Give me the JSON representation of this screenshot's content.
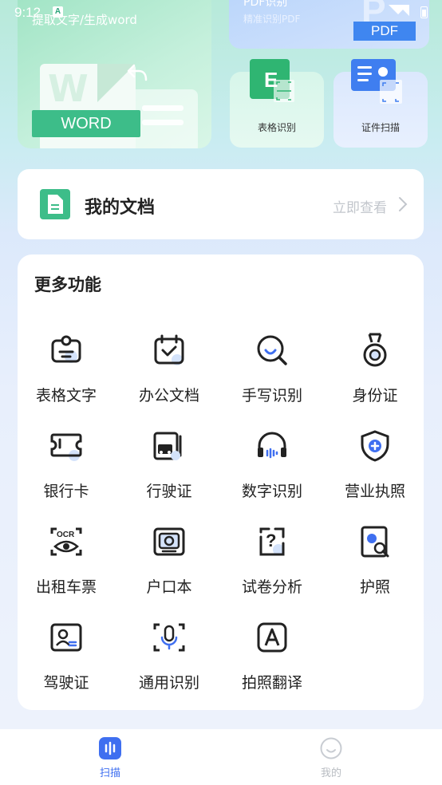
{
  "status_bar": {
    "time": "9:12",
    "notification_glyph": "A"
  },
  "hero": {
    "word_card": {
      "subtitle": "提取文字/生成word",
      "badge": "WORD",
      "watermark": "W"
    },
    "pdf_card": {
      "title": "PDF识别",
      "subtitle": "精准识别PDF",
      "badge": "PDF",
      "watermark": "P"
    },
    "table_card": {
      "label": "表格识别"
    },
    "id_card": {
      "label": "证件扫描"
    }
  },
  "my_docs": {
    "title": "我的文档",
    "link": "立即查看"
  },
  "more": {
    "title": "更多功能",
    "items": [
      {
        "label": "表格文字",
        "icon": "clipboard-icon"
      },
      {
        "label": "办公文档",
        "icon": "calendar-check-icon"
      },
      {
        "label": "手写识别",
        "icon": "magnifier-icon"
      },
      {
        "label": "身份证",
        "icon": "medal-icon"
      },
      {
        "label": "银行卡",
        "icon": "ticket-card-icon"
      },
      {
        "label": "行驶证",
        "icon": "vehicle-license-icon"
      },
      {
        "label": "数字识别",
        "icon": "headphones-icon"
      },
      {
        "label": "营业执照",
        "icon": "shield-plus-icon"
      },
      {
        "label": "出租车票",
        "icon": "ocr-eye-icon"
      },
      {
        "label": "户口本",
        "icon": "booklet-icon"
      },
      {
        "label": "试卷分析",
        "icon": "question-icon"
      },
      {
        "label": "护照",
        "icon": "passport-icon"
      },
      {
        "label": "驾驶证",
        "icon": "driver-license-icon"
      },
      {
        "label": "通用识别",
        "icon": "scan-mic-icon"
      },
      {
        "label": "拍照翻译",
        "icon": "translate-a-icon"
      }
    ]
  },
  "tabbar": {
    "scan": "扫描",
    "mine": "我的"
  },
  "colors": {
    "accent_green": "#3dbd89",
    "accent_blue": "#3f6ff0",
    "icon_dark": "#222222",
    "icon_soft_blue": "#d4e3fb"
  }
}
